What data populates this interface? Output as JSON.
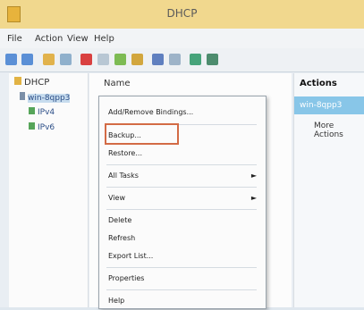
{
  "window": {
    "title": "DHCP"
  },
  "menu": [
    "File",
    "Action",
    "View",
    "Help"
  ],
  "tree": {
    "root": "DHCP",
    "server": "win-8qpp3",
    "children": [
      "IPv4",
      "IPv6"
    ]
  },
  "list": {
    "column": "Name"
  },
  "actions": {
    "header": "Actions",
    "server": "win-8qpp3",
    "more": "More Actions"
  },
  "context_menu": {
    "items": [
      {
        "label": "Add/Remove Bindings...",
        "arrow": ""
      },
      {
        "label": "Backup...",
        "arrow": "",
        "highlighted": true
      },
      {
        "label": "Restore...",
        "arrow": ""
      },
      {
        "label": "All Tasks",
        "arrow": "►"
      },
      {
        "label": "View",
        "arrow": "►"
      },
      {
        "label": "Delete",
        "arrow": ""
      },
      {
        "label": "Refresh",
        "arrow": ""
      },
      {
        "label": "Export List...",
        "arrow": ""
      },
      {
        "label": "Properties",
        "arrow": ""
      },
      {
        "label": "Help",
        "arrow": ""
      }
    ]
  },
  "colors": {
    "titlebar": "#f1d88e",
    "highlight": "#d36b45",
    "selected": "#88c6e8"
  }
}
